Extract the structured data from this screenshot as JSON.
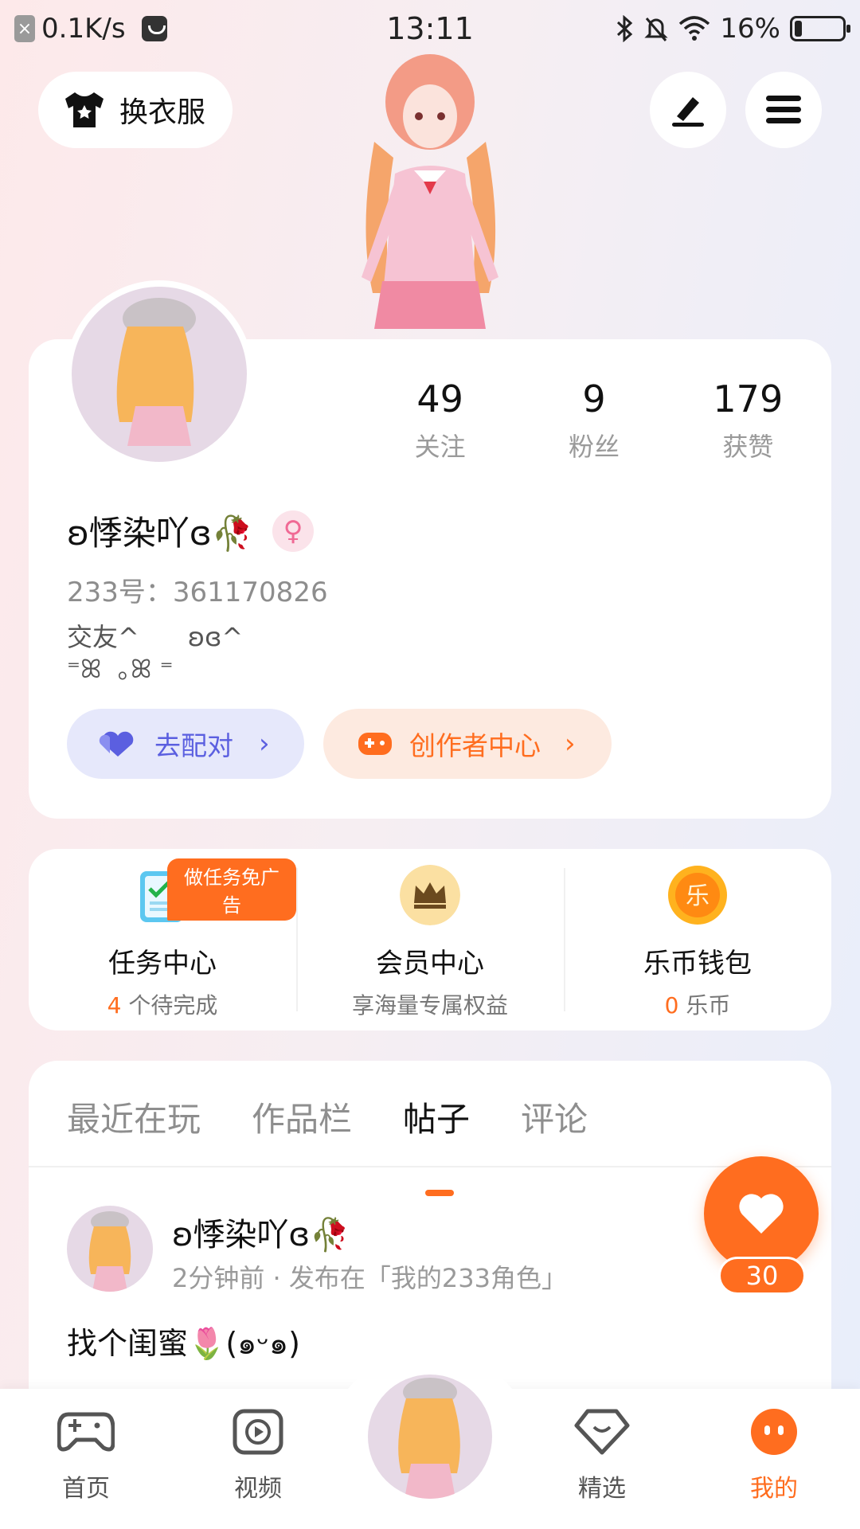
{
  "status_bar": {
    "speed": "0.1K/s",
    "time": "13:11",
    "battery": "16%",
    "battery_level": 0.16,
    "icons": [
      "close-notification-icon",
      "app-icon",
      "bluetooth-icon",
      "mute-icon",
      "wifi-icon",
      "battery-icon"
    ]
  },
  "header": {
    "outfit_label": "换衣服",
    "icons": [
      "shirt-icon",
      "edit-icon",
      "menu-icon"
    ]
  },
  "profile": {
    "stats": [
      {
        "value": "49",
        "label": "关注"
      },
      {
        "value": "9",
        "label": "粉丝"
      },
      {
        "value": "179",
        "label": "获赞"
      }
    ],
    "nickname": "ʚ悸染吖ɞ🥀",
    "gender_symbol": "♀",
    "uid": "233号：361170826",
    "bio": "交友^      ʚɞ^\n⁼ꕤ  ｡ꕤ ⁼",
    "match_label": "去配对",
    "creator_label": "创作者中心"
  },
  "services": [
    {
      "title": "任务中心",
      "highlight": "4",
      "sub": " 个待完成",
      "badge": "做任务免广告",
      "icon": "task-icon"
    },
    {
      "title": "会员中心",
      "sub_full": "享海量专属权益",
      "icon": "crown-icon"
    },
    {
      "title": "乐币钱包",
      "highlight": "0",
      "sub": " 乐币",
      "icon": "coin-icon",
      "coin_char": "乐"
    }
  ],
  "tabs": [
    "最近在玩",
    "作品栏",
    "帖子",
    "评论"
  ],
  "active_tab": "帖子",
  "post": {
    "author": "ʚ悸染吖ɞ🥀",
    "meta": "2分钟前 · 发布在「我的233角色」",
    "text": "找个闺蜜🌷(๑ᵕ๑)",
    "likes": "30"
  },
  "bottom_nav": [
    {
      "label": "首页",
      "icon": "gamepad-icon"
    },
    {
      "label": "视频",
      "icon": "video-icon"
    },
    {
      "label": "",
      "icon": "avatar"
    },
    {
      "label": "精选",
      "icon": "heart-diamond-icon"
    },
    {
      "label": "我的",
      "icon": "profile-face-icon",
      "active": true
    }
  ],
  "colors": {
    "accent": "#ff6d1f",
    "match": "#5b5fe0",
    "gender": "#f06a95"
  }
}
